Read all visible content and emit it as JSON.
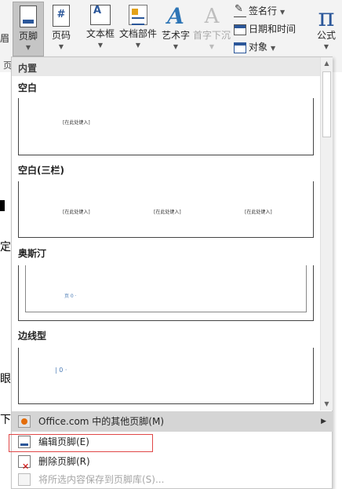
{
  "ribbon": {
    "left_stub": "眉",
    "footer_btn": "页脚",
    "pagenum_btn": "页码",
    "textbox_btn": "文本框",
    "docparts_btn": "文档部件",
    "wordart_btn": "艺术字",
    "dropcap_btn": "首字下沉",
    "signature": "签名行",
    "datetime": "日期和时间",
    "object": "对象",
    "equation_btn": "公式",
    "group_stub": "页"
  },
  "doc": {
    "frag1": "定",
    "frag2": "眼",
    "frag3": "下"
  },
  "gallery": {
    "section": "内置",
    "items": [
      {
        "title": "空白",
        "placeholders": [
          "[在此处键入]"
        ]
      },
      {
        "title": "空白(三栏)",
        "placeholders": [
          "[在此处键入]",
          "[在此处键入]",
          "[在此处键入]"
        ]
      },
      {
        "title": "奥斯汀",
        "placeholders": [
          "页 0 ·"
        ]
      },
      {
        "title": "边线型",
        "placeholders": [
          "| 0 ·"
        ]
      }
    ]
  },
  "commands": {
    "more": "Office.com 中的其他页脚(M)",
    "edit": "编辑页脚(E)",
    "remove": "删除页脚(R)",
    "save": "将所选内容保存到页脚库(S)..."
  },
  "colors": {
    "accent": "#2b579a",
    "highlight": "#e04848"
  }
}
